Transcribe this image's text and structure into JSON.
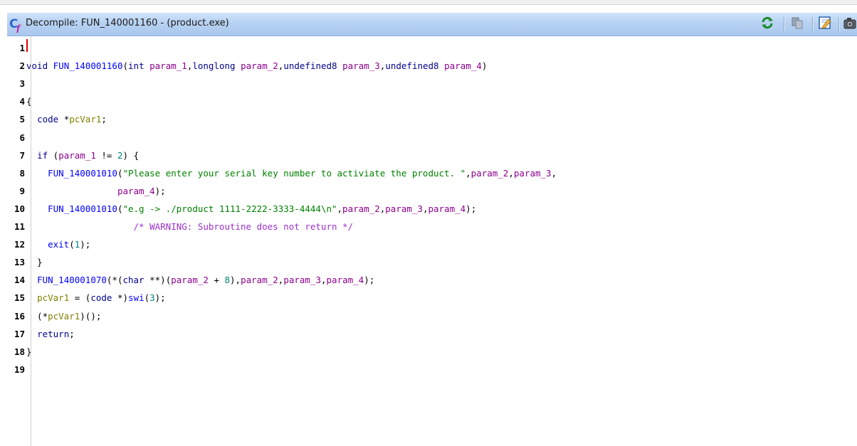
{
  "window": {
    "title": "Decompile: FUN_140001160 -  (product.exe)"
  },
  "toolbar": {
    "buttons": [
      {
        "icon": "refresh-icon"
      },
      {
        "icon": "copy-icon"
      },
      {
        "icon": "edit-icon"
      },
      {
        "icon": "snapshot-icon"
      }
    ]
  },
  "colors": {
    "keyword": "#00008b",
    "function": "#0000ff",
    "variable": "#808000",
    "parameter": "#8b008b",
    "string": "#008000",
    "number": "#008080",
    "comment": "#9b30c8",
    "cursor": "#e00000",
    "titlebar": "#b7d2f2"
  },
  "code": {
    "lines": [
      {
        "num": "1",
        "tokens": []
      },
      {
        "num": "2",
        "tokens": [
          {
            "t": "void",
            "c": "kw"
          },
          {
            "t": " "
          },
          {
            "t": "FUN_140001160",
            "c": "fn"
          },
          {
            "t": "("
          },
          {
            "t": "int",
            "c": "kw"
          },
          {
            "t": " "
          },
          {
            "t": "param_1",
            "c": "prm"
          },
          {
            "t": ","
          },
          {
            "t": "longlong",
            "c": "kw"
          },
          {
            "t": " "
          },
          {
            "t": "param_2",
            "c": "prm"
          },
          {
            "t": ","
          },
          {
            "t": "undefined8",
            "c": "kw"
          },
          {
            "t": " "
          },
          {
            "t": "param_3",
            "c": "prm"
          },
          {
            "t": ","
          },
          {
            "t": "undefined8",
            "c": "kw"
          },
          {
            "t": " "
          },
          {
            "t": "param_4",
            "c": "prm"
          },
          {
            "t": ")"
          }
        ]
      },
      {
        "num": "3",
        "tokens": []
      },
      {
        "num": "4",
        "tokens": [
          {
            "t": "{"
          }
        ]
      },
      {
        "num": "5",
        "tokens": [
          {
            "t": "  "
          },
          {
            "t": "code",
            "c": "kw"
          },
          {
            "t": " *"
          },
          {
            "t": "pcVar1",
            "c": "var"
          },
          {
            "t": ";"
          }
        ]
      },
      {
        "num": "6",
        "tokens": []
      },
      {
        "num": "7",
        "tokens": [
          {
            "t": "  "
          },
          {
            "t": "if",
            "c": "kw"
          },
          {
            "t": " ("
          },
          {
            "t": "param_1",
            "c": "prm"
          },
          {
            "t": " != "
          },
          {
            "t": "2",
            "c": "num"
          },
          {
            "t": ") {"
          }
        ]
      },
      {
        "num": "8",
        "tokens": [
          {
            "t": "    "
          },
          {
            "t": "FUN_140001010",
            "c": "fn"
          },
          {
            "t": "("
          },
          {
            "t": "\"Please enter your serial key number to activiate the product. \"",
            "c": "str"
          },
          {
            "t": ","
          },
          {
            "t": "param_2",
            "c": "prm"
          },
          {
            "t": ","
          },
          {
            "t": "param_3",
            "c": "prm"
          },
          {
            "t": ","
          }
        ]
      },
      {
        "num": "9",
        "tokens": [
          {
            "t": "                 "
          },
          {
            "t": "param_4",
            "c": "prm"
          },
          {
            "t": ");"
          }
        ]
      },
      {
        "num": "10",
        "tokens": [
          {
            "t": "    "
          },
          {
            "t": "FUN_140001010",
            "c": "fn"
          },
          {
            "t": "("
          },
          {
            "t": "\"e.g -> ./product 1111-2222-3333-4444\\n\"",
            "c": "str"
          },
          {
            "t": ","
          },
          {
            "t": "param_2",
            "c": "prm"
          },
          {
            "t": ","
          },
          {
            "t": "param_3",
            "c": "prm"
          },
          {
            "t": ","
          },
          {
            "t": "param_4",
            "c": "prm"
          },
          {
            "t": ");"
          }
        ]
      },
      {
        "num": "11",
        "tokens": [
          {
            "t": "                    "
          },
          {
            "t": "/* WARNING: Subroutine does not return */",
            "c": "cmt"
          }
        ]
      },
      {
        "num": "12",
        "tokens": [
          {
            "t": "    "
          },
          {
            "t": "exit",
            "c": "fn"
          },
          {
            "t": "("
          },
          {
            "t": "1",
            "c": "num"
          },
          {
            "t": ");"
          }
        ]
      },
      {
        "num": "13",
        "tokens": [
          {
            "t": "  }"
          }
        ]
      },
      {
        "num": "14",
        "tokens": [
          {
            "t": "  "
          },
          {
            "t": "FUN_140001070",
            "c": "fn"
          },
          {
            "t": "(*("
          },
          {
            "t": "char",
            "c": "kw"
          },
          {
            "t": " **)("
          },
          {
            "t": "param_2",
            "c": "prm"
          },
          {
            "t": " + "
          },
          {
            "t": "8",
            "c": "num"
          },
          {
            "t": "),"
          },
          {
            "t": "param_2",
            "c": "prm"
          },
          {
            "t": ","
          },
          {
            "t": "param_3",
            "c": "prm"
          },
          {
            "t": ","
          },
          {
            "t": "param_4",
            "c": "prm"
          },
          {
            "t": ");"
          }
        ]
      },
      {
        "num": "15",
        "tokens": [
          {
            "t": "  "
          },
          {
            "t": "pcVar1",
            "c": "var"
          },
          {
            "t": " = ("
          },
          {
            "t": "code",
            "c": "kw"
          },
          {
            "t": " *)"
          },
          {
            "t": "swi",
            "c": "fn"
          },
          {
            "t": "("
          },
          {
            "t": "3",
            "c": "num"
          },
          {
            "t": ");"
          }
        ]
      },
      {
        "num": "16",
        "tokens": [
          {
            "t": "  (*"
          },
          {
            "t": "pcVar1",
            "c": "var"
          },
          {
            "t": ")();"
          }
        ]
      },
      {
        "num": "17",
        "tokens": [
          {
            "t": "  "
          },
          {
            "t": "return",
            "c": "kw"
          },
          {
            "t": ";"
          }
        ]
      },
      {
        "num": "18",
        "tokens": [
          {
            "t": "}"
          }
        ]
      },
      {
        "num": "19",
        "tokens": []
      }
    ]
  }
}
